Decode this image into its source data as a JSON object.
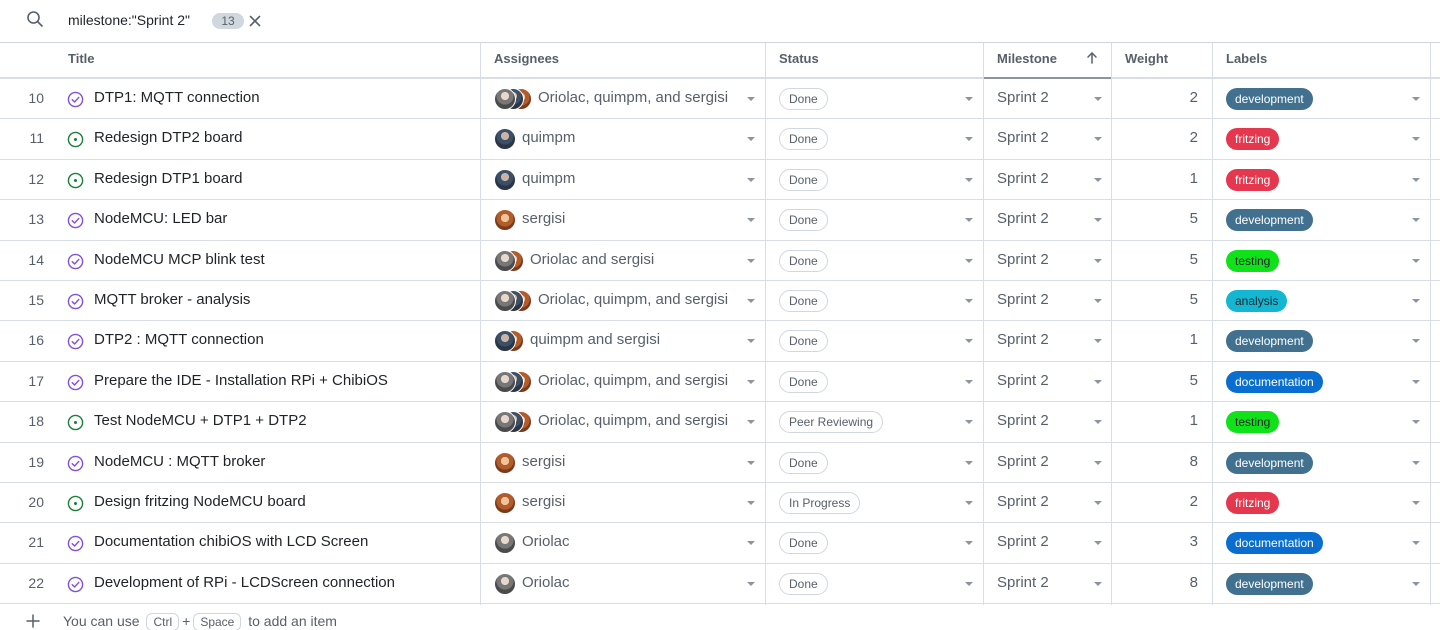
{
  "filter": {
    "query": "milestone:\"Sprint 2\"",
    "count": "13"
  },
  "columns": {
    "title": "Title",
    "assignees": "Assignees",
    "status": "Status",
    "milestone": "Milestone",
    "weight": "Weight",
    "labels": "Labels"
  },
  "label_colors": {
    "development": {
      "bg": "#41718f",
      "fg": "#ffffff"
    },
    "fritzing": {
      "bg": "#e5374e",
      "fg": "#ffffff"
    },
    "testing": {
      "bg": "#10e21a",
      "fg": "#1f2328"
    },
    "analysis": {
      "bg": "#14b7d1",
      "fg": "#1f2328"
    },
    "documentation": {
      "bg": "#0a6ed0",
      "fg": "#ffffff"
    }
  },
  "rows": [
    {
      "num": "10",
      "state": "closed",
      "title": "DTP1: MQTT connection",
      "avatars": [
        "a-orio",
        "a-quim",
        "a-serg"
      ],
      "assignees": "Oriolac, quimpm, and sergisi",
      "status": "Done",
      "milestone": "Sprint 2",
      "weight": "2",
      "label": "development"
    },
    {
      "num": "11",
      "state": "open",
      "title": "Redesign DTP2 board",
      "avatars": [
        "a-quim"
      ],
      "assignees": "quimpm",
      "status": "Done",
      "milestone": "Sprint 2",
      "weight": "2",
      "label": "fritzing"
    },
    {
      "num": "12",
      "state": "open",
      "title": "Redesign DTP1 board",
      "avatars": [
        "a-quim"
      ],
      "assignees": "quimpm",
      "status": "Done",
      "milestone": "Sprint 2",
      "weight": "1",
      "label": "fritzing"
    },
    {
      "num": "13",
      "state": "closed",
      "title": "NodeMCU: LED bar",
      "avatars": [
        "a-serg"
      ],
      "assignees": "sergisi",
      "status": "Done",
      "milestone": "Sprint 2",
      "weight": "5",
      "label": "development"
    },
    {
      "num": "14",
      "state": "closed",
      "title": "NodeMCU MCP blink test",
      "avatars": [
        "a-orio",
        "a-serg"
      ],
      "assignees": "Oriolac and sergisi",
      "status": "Done",
      "milestone": "Sprint 2",
      "weight": "5",
      "label": "testing"
    },
    {
      "num": "15",
      "state": "closed",
      "title": "MQTT broker - analysis",
      "avatars": [
        "a-orio",
        "a-quim",
        "a-serg"
      ],
      "assignees": "Oriolac, quimpm, and sergisi",
      "status": "Done",
      "milestone": "Sprint 2",
      "weight": "5",
      "label": "analysis"
    },
    {
      "num": "16",
      "state": "closed",
      "title": "DTP2 : MQTT connection",
      "avatars": [
        "a-quim",
        "a-serg"
      ],
      "assignees": "quimpm and sergisi",
      "status": "Done",
      "milestone": "Sprint 2",
      "weight": "1",
      "label": "development"
    },
    {
      "num": "17",
      "state": "closed",
      "title": "Prepare the IDE - Installation RPi + ChibiOS",
      "avatars": [
        "a-orio",
        "a-quim",
        "a-serg"
      ],
      "assignees": "Oriolac, quimpm, and sergisi",
      "status": "Done",
      "milestone": "Sprint 2",
      "weight": "5",
      "label": "documentation"
    },
    {
      "num": "18",
      "state": "open",
      "title": "Test NodeMCU + DTP1 + DTP2",
      "avatars": [
        "a-orio",
        "a-quim",
        "a-serg"
      ],
      "assignees": "Oriolac, quimpm, and sergisi",
      "status": "Peer Reviewing",
      "milestone": "Sprint 2",
      "weight": "1",
      "label": "testing"
    },
    {
      "num": "19",
      "state": "closed",
      "title": "NodeMCU : MQTT broker",
      "avatars": [
        "a-serg"
      ],
      "assignees": "sergisi",
      "status": "Done",
      "milestone": "Sprint 2",
      "weight": "8",
      "label": "development"
    },
    {
      "num": "20",
      "state": "open",
      "title": "Design fritzing NodeMCU board",
      "avatars": [
        "a-serg"
      ],
      "assignees": "sergisi",
      "status": "In Progress",
      "milestone": "Sprint 2",
      "weight": "2",
      "label": "fritzing"
    },
    {
      "num": "21",
      "state": "closed",
      "title": "Documentation chibiOS with LCD Screen",
      "avatars": [
        "a-orio"
      ],
      "assignees": "Oriolac",
      "status": "Done",
      "milestone": "Sprint 2",
      "weight": "3",
      "label": "documentation"
    },
    {
      "num": "22",
      "state": "closed",
      "title": "Development of RPi - LCDScreen connection",
      "avatars": [
        "a-orio"
      ],
      "assignees": "Oriolac",
      "status": "Done",
      "milestone": "Sprint 2",
      "weight": "8",
      "label": "development"
    }
  ],
  "footer": {
    "hint_before": "You can use",
    "key1": "Ctrl",
    "plus": "+",
    "key2": "Space",
    "hint_after": "to add an item"
  }
}
